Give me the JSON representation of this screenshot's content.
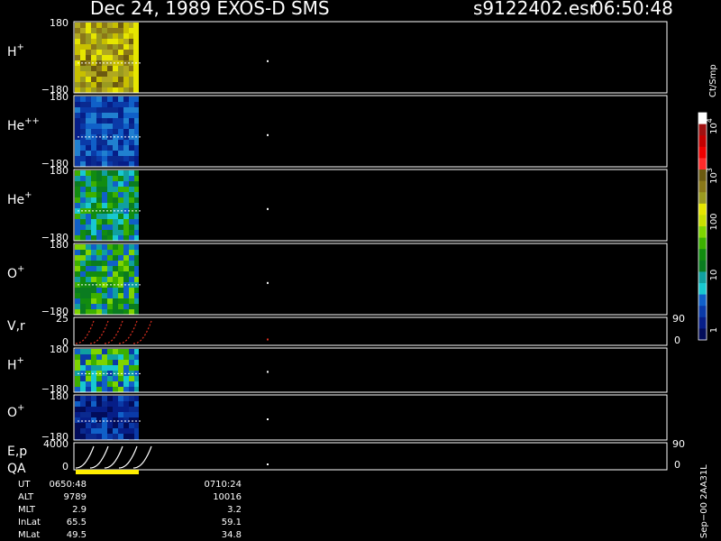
{
  "header": {
    "title": "Dec 24, 1989   EXOS-D SMS",
    "file": "s9122402.esr",
    "time": "06:50:48"
  },
  "colorbar": {
    "unit": "Ct/Smp",
    "tick_labels": [
      {
        "base": "10",
        "exp": "4"
      },
      {
        "base": "10",
        "exp": "3"
      },
      {
        "base": "100",
        "exp": ""
      },
      {
        "base": "10",
        "exp": ""
      },
      {
        "base": "1",
        "exp": ""
      }
    ],
    "colors": [
      "#ffffff",
      "#a01010",
      "#c40000",
      "#ee0000",
      "#ff2a2a",
      "#6c5a10",
      "#8a7818",
      "#9a9a20",
      "#e6e600",
      "#c8e000",
      "#7ed400",
      "#3cb000",
      "#128c10",
      "#0a7c20",
      "#10a0a0",
      "#18c8d0",
      "#1060c8",
      "#0a3aa8",
      "#061e88",
      "#020c5a"
    ]
  },
  "panels": [
    {
      "id": "h-plus-1",
      "label": "H",
      "sup": "+",
      "ymax": "180",
      "ymin": "−180"
    },
    {
      "id": "he-plus-plus",
      "label": "He",
      "sup": "++",
      "ymax": "180",
      "ymin": "−180"
    },
    {
      "id": "he-plus",
      "label": "He",
      "sup": "+",
      "ymax": "180",
      "ymin": "−180"
    },
    {
      "id": "o-plus-1",
      "label": "O",
      "sup": "+",
      "ymax": "180",
      "ymin": "−180"
    },
    {
      "id": "vr",
      "label": "V,r",
      "sup": "",
      "ymax": "25",
      "ymin": "0",
      "right_top": "90",
      "right_bottom": "0"
    },
    {
      "id": "h-plus-2",
      "label": "H",
      "sup": "+",
      "ymax": "180",
      "ymin": "−180"
    },
    {
      "id": "o-plus-2",
      "label": "O",
      "sup": "+",
      "ymax": "180",
      "ymin": "−180"
    },
    {
      "id": "ep",
      "label": "E,p",
      "sup": "",
      "ymax": "4000",
      "ymin": "0",
      "right_top": "90",
      "right_bottom": "0"
    }
  ],
  "qa_label": "QA",
  "ephemeris": {
    "rows": [
      {
        "name": "UT",
        "v1": "0650:48",
        "v2": "0710:24"
      },
      {
        "name": "ALT",
        "v1": "9789",
        "v2": "10016"
      },
      {
        "name": "MLT",
        "v1": "2.9",
        "v2": "3.2"
      },
      {
        "name": "InLat",
        "v1": "65.5",
        "v2": "59.1"
      },
      {
        "name": "MLat",
        "v1": "49.5",
        "v2": "34.8"
      }
    ]
  },
  "footer_vertical": "Sep−00 2AA31L",
  "colors": {
    "background": "#000000",
    "axis": "#ffffff",
    "qa_bar": "#ffee00",
    "vr_curve": "#e03020",
    "ep_curve": "#ffffff"
  },
  "chart_data": {
    "type": "heatmap",
    "title": "Dec 24, 1989   EXOS-D SMS",
    "x_time_labels": [
      "0650:48",
      "0710:24"
    ],
    "series": [
      {
        "name": "H+",
        "ylim": [
          -180,
          180
        ],
        "dominant_level": "100"
      },
      {
        "name": "He++",
        "ylim": [
          -180,
          180
        ],
        "dominant_level": "1-10"
      },
      {
        "name": "He+",
        "ylim": [
          -180,
          180
        ],
        "dominant_level": "10"
      },
      {
        "name": "O+",
        "ylim": [
          -180,
          180
        ],
        "dominant_level": "10"
      },
      {
        "name": "V,r",
        "ylim": [
          0,
          25
        ],
        "right_ylim": [
          0,
          90
        ]
      },
      {
        "name": "H+",
        "ylim": [
          -180,
          180
        ],
        "dominant_level": "10"
      },
      {
        "name": "O+",
        "ylim": [
          -180,
          180
        ],
        "dominant_level": "1"
      },
      {
        "name": "E,p",
        "ylim": [
          0,
          4000
        ],
        "right_ylim": [
          0,
          90
        ]
      }
    ],
    "colorbar_range": [
      1,
      10000
    ],
    "colorbar_scale": "log"
  }
}
